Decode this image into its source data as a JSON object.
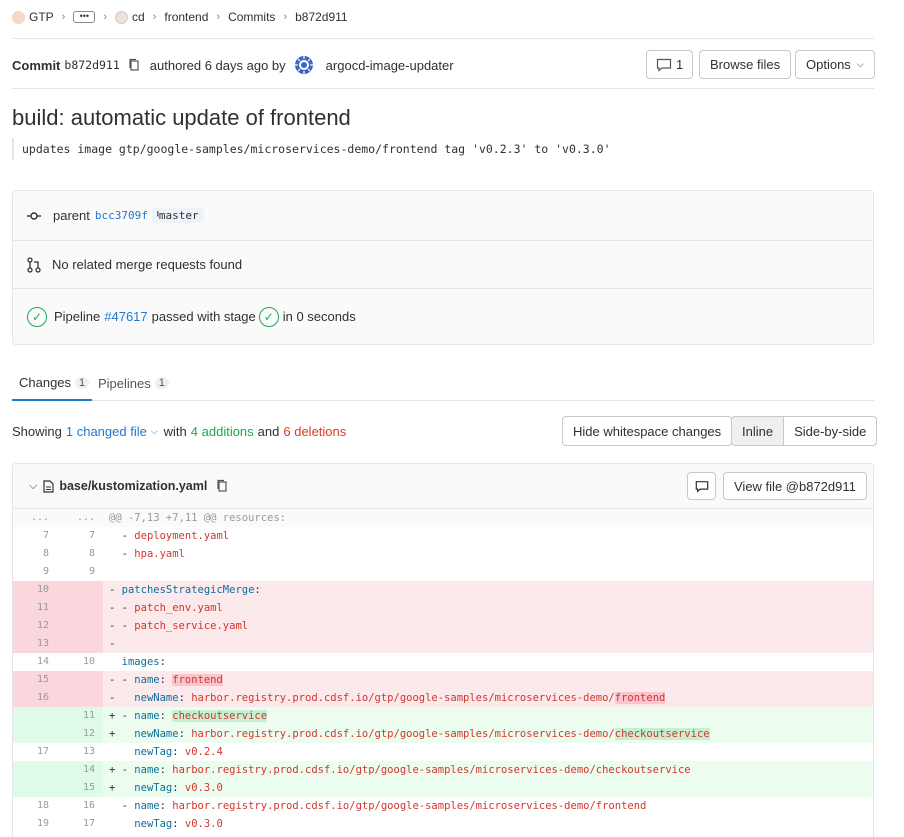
{
  "breadcrumb": {
    "group": "GTP",
    "ellipsis": "•••",
    "project": "cd",
    "subproject": "frontend",
    "commits": "Commits",
    "current": "b872d911"
  },
  "commit": {
    "label": "Commit",
    "sha": "b872d911",
    "authored": "authored 6 days ago by",
    "author": "argocd-image-updater",
    "comments_count": "1",
    "browse_files": "Browse files",
    "options": "Options"
  },
  "title": "build: automatic update of frontend",
  "description": "updates image gtp/google-samples/microservices-demo/frontend tag 'v0.2.3' to 'v0.3.0'",
  "info": {
    "parent_label": "parent",
    "parent_sha": "bcc3709f",
    "branch": "master",
    "merge_requests": "No related merge requests found",
    "pipeline_label": "Pipeline",
    "pipeline_id": "#47617",
    "pipeline_passed": "passed with stage",
    "pipeline_time": "in 0 seconds"
  },
  "tabs": [
    {
      "label": "Changes",
      "count": "1",
      "active": true
    },
    {
      "label": "Pipelines",
      "count": "1",
      "active": false
    }
  ],
  "showing": {
    "prefix": "Showing",
    "changed": "1 changed file",
    "with": "with",
    "additions": "4 additions",
    "and": "and",
    "deletions": "6 deletions",
    "hide_whitespace": "Hide whitespace changes",
    "inline": "Inline",
    "side_by_side": "Side-by-side"
  },
  "file": {
    "name": "base/kustomization.yaml",
    "view_file": "View file @b872d911"
  },
  "diff": [
    {
      "type": "hunk",
      "old": "...",
      "new": "...",
      "text": "@@ -7,13 +7,11 @@ resources:"
    },
    {
      "type": "ctx",
      "old": "7",
      "new": "7",
      "text": "  - deployment.yaml"
    },
    {
      "type": "ctx",
      "old": "8",
      "new": "8",
      "text": "  - hpa.yaml"
    },
    {
      "type": "ctx",
      "old": "9",
      "new": "9",
      "text": ""
    },
    {
      "type": "old",
      "old": "10",
      "new": "",
      "text": "- patchesStrategicMerge:"
    },
    {
      "type": "old",
      "old": "11",
      "new": "",
      "text": "- - patch_env.yaml"
    },
    {
      "type": "old",
      "old": "12",
      "new": "",
      "text": "- - patch_service.yaml"
    },
    {
      "type": "old",
      "old": "13",
      "new": "",
      "text": "-"
    },
    {
      "type": "ctx",
      "old": "14",
      "new": "10",
      "text": "  images:"
    },
    {
      "type": "old",
      "old": "15",
      "new": "",
      "text": "- - name: ",
      "hl": "frontend"
    },
    {
      "type": "old",
      "old": "16",
      "new": "",
      "text": "-   newName: harbor.registry.prod.cdsf.io/gtp/google-samples/microservices-demo/",
      "hl": "frontend"
    },
    {
      "type": "new",
      "old": "",
      "new": "11",
      "text": "+ - name: ",
      "hl": "checkoutservice"
    },
    {
      "type": "new",
      "old": "",
      "new": "12",
      "text": "+   newName: harbor.registry.prod.cdsf.io/gtp/google-samples/microservices-demo/",
      "hl": "checkoutservice"
    },
    {
      "type": "ctx",
      "old": "17",
      "new": "13",
      "text": "    newTag: v0.2.4"
    },
    {
      "type": "new",
      "old": "",
      "new": "14",
      "text": "+ - name: harbor.registry.prod.cdsf.io/gtp/google-samples/microservices-demo/checkoutservice"
    },
    {
      "type": "new",
      "old": "",
      "new": "15",
      "text": "+   newTag: v0.3.0"
    },
    {
      "type": "ctx",
      "old": "18",
      "new": "16",
      "text": "  - name: harbor.registry.prod.cdsf.io/gtp/google-samples/microservices-demo/frontend"
    },
    {
      "type": "ctx",
      "old": "19",
      "new": "17",
      "text": "    newTag: v0.3.0"
    }
  ],
  "colors": {
    "link": "#1f78d1",
    "success": "#1aaa55",
    "danger": "#db3b21",
    "removed_bg": "#fbe9eb",
    "added_bg": "#ecfdf0"
  }
}
